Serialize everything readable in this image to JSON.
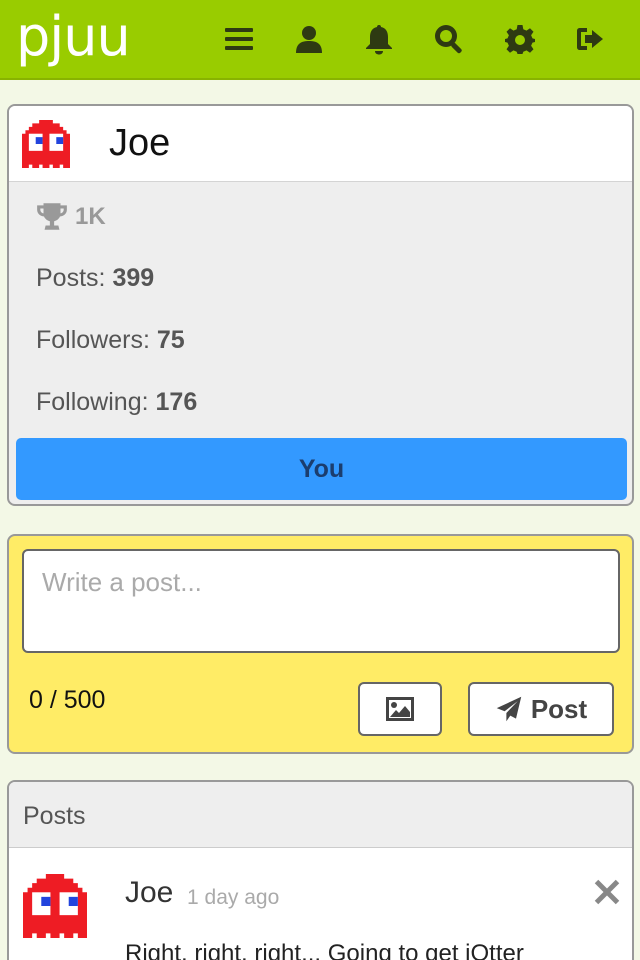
{
  "app": {
    "logo": "pjuu"
  },
  "nav": {
    "icons": [
      "menu-icon",
      "profile-icon",
      "notifications-icon",
      "search-icon",
      "settings-icon",
      "signout-icon"
    ]
  },
  "profile": {
    "name": "Joe",
    "score": "1K",
    "posts_label": "Posts:",
    "posts_count": "399",
    "followers_label": "Followers:",
    "followers_count": "75",
    "following_label": "Following:",
    "following_count": "176",
    "you_label": "You"
  },
  "composer": {
    "placeholder": "Write a post...",
    "value": "",
    "counter": "0 / 500",
    "post_label": "Post"
  },
  "posts": {
    "title": "Posts",
    "items": [
      {
        "author": "Joe",
        "time": "1 day ago",
        "body": "Right, right, right... Going to get jOtter"
      }
    ]
  },
  "colors": {
    "brand": "#99cc00",
    "accent": "#3399ff",
    "composer_bg": "#ffec66",
    "page_bg": "#f3f8e6"
  }
}
